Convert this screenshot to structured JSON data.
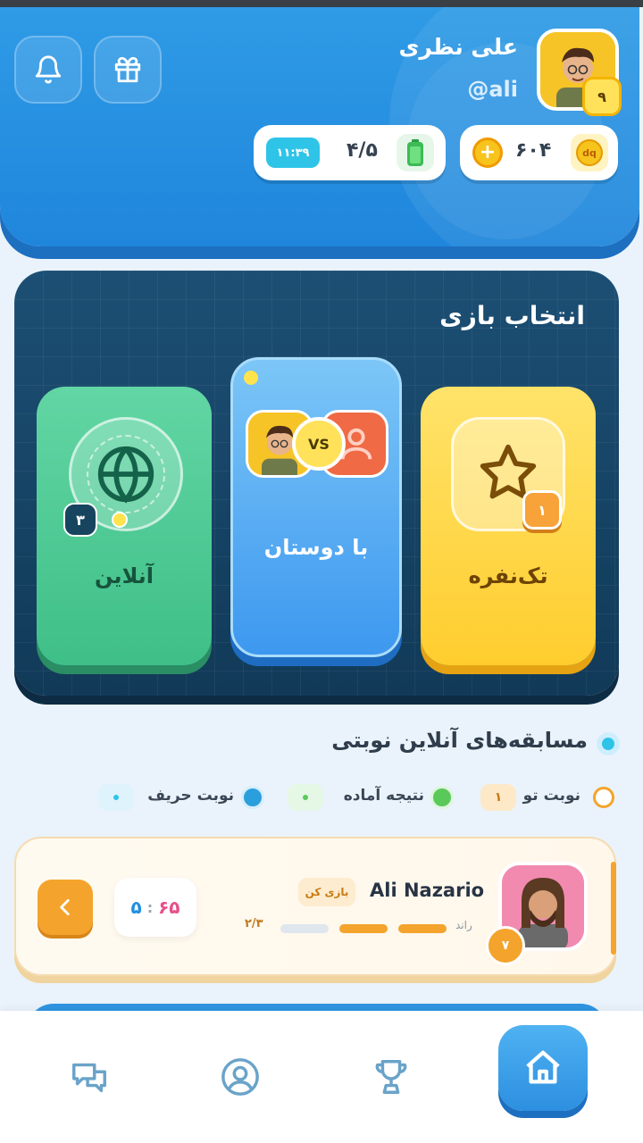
{
  "header": {
    "user_name": "علی نظری",
    "user_handle": "@ali",
    "level": "۹",
    "coins": "۶۰۴",
    "coin_badge": "dq",
    "energy": "۴/۵",
    "energy_timer": "۱۱:۳۹"
  },
  "game_select": {
    "title": "انتخاب بازی",
    "modes": [
      {
        "label": "تک‌نفره",
        "badge": "۱"
      },
      {
        "label": "با دوستان",
        "vs": "VS"
      },
      {
        "label": "آنلاین",
        "badge": "۳"
      }
    ]
  },
  "turn_matches": {
    "title": "مسابقه‌های آنلاین نوبتی",
    "legend": {
      "your_turn": "نوبت تو",
      "your_turn_count": "۱",
      "result_ready": "نتیجه آماده",
      "opponent_turn": "نوبت حریف"
    },
    "match": {
      "opponent": "Ali Nazario",
      "play_label": "بازی کن",
      "round_label": "راند",
      "round_progress": "۲/۳",
      "score_left": "۵",
      "score_sep": ":",
      "score_right": "۶۵",
      "opponent_level": "۷"
    }
  },
  "colors": {
    "header_blue": "#2f9be6",
    "panel_navy": "#1c4f74",
    "solo_yellow": "#ffd23a",
    "friends_blue": "#4aa6f2",
    "online_green": "#4fcf98",
    "accent_orange": "#f4a42c"
  }
}
